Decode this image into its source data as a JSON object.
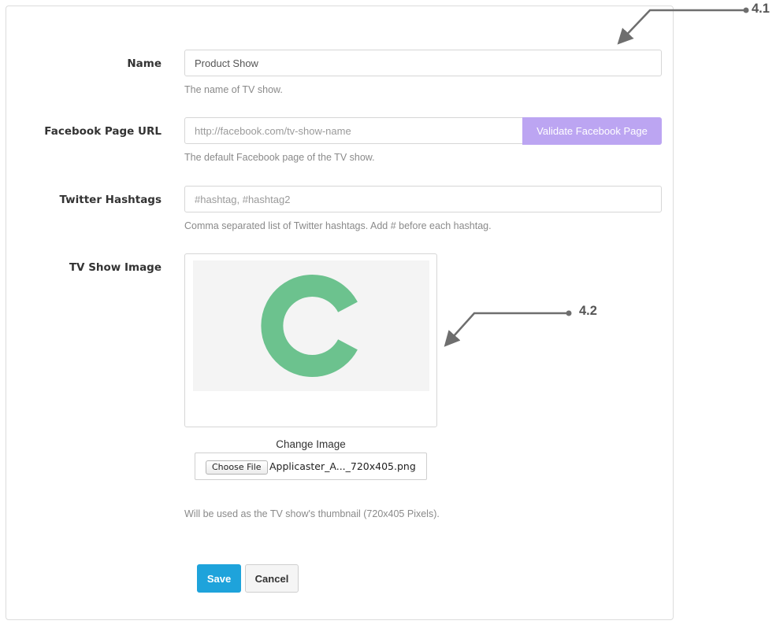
{
  "form": {
    "name": {
      "label": "Name",
      "value": "Product Show",
      "help": "The name of TV show."
    },
    "facebook": {
      "label": "Facebook Page URL",
      "placeholder": "http://facebook.com/tv-show-name",
      "help": "The default Facebook page of the TV show.",
      "validate_label": "Validate Facebook Page"
    },
    "twitter": {
      "label": "Twitter Hashtags",
      "placeholder": "#hashtag, #hashtag2",
      "help": "Comma separated list of Twitter hashtags. Add # before each hashtag."
    },
    "image": {
      "label": "TV Show Image",
      "change_label": "Change Image",
      "choose_file_label": "Choose File",
      "file_name": "Applicaster_A..._720x405.png",
      "help": "Will be used as the TV show's thumbnail (720x405 Pixels).",
      "logo_color": "#6cc28e",
      "logo_icon": "c-logo-icon"
    },
    "actions": {
      "save_label": "Save",
      "cancel_label": "Cancel"
    }
  },
  "callouts": {
    "first": "4.1",
    "second": "4.2"
  },
  "colors": {
    "primary": "#1ea3db",
    "validate": "#bca5f2",
    "callout": "#6e6e6e"
  }
}
